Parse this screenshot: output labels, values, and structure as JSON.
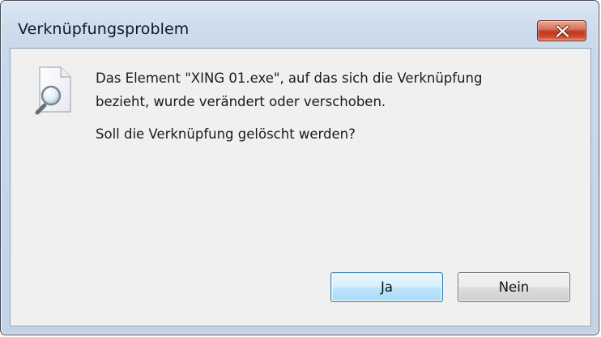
{
  "dialog": {
    "title": "Verknüpfungsproblem",
    "close_icon": "close-x-icon",
    "close_color": "#c9492a",
    "icon": "document-magnifier-icon",
    "message_line1": "Das Element \"XING 01.exe\", auf das sich die Verknüpfung",
    "message_line2": "bezieht, wurde verändert oder verschoben.",
    "question": "Soll die Verknüpfung gelöscht werden?",
    "buttons": {
      "yes_label": "Ja",
      "no_label": "Nein"
    }
  }
}
